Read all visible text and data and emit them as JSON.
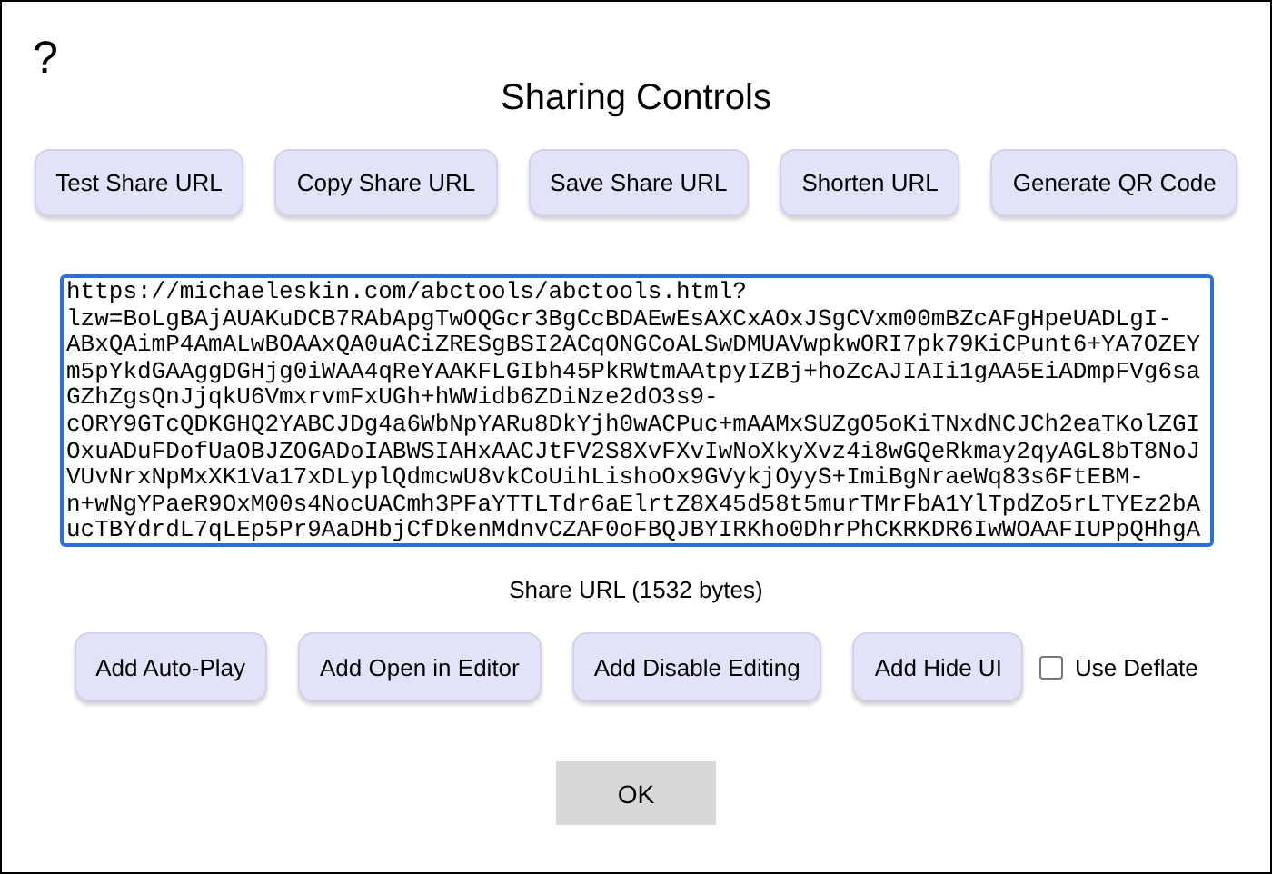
{
  "help_glyph": "?",
  "title": "Sharing Controls",
  "top_buttons": [
    "Test Share URL",
    "Copy Share URL",
    "Save Share URL",
    "Shorten URL",
    "Generate QR Code"
  ],
  "share_url_lines": [
    "https://michaeleskin.com/abctools/abctools.html?",
    "lzw=BoLgBAjAUAKuDCB7RAbApgTwOQGcr3BgCcBDAEwEsAXCxAOxJSgCVxm00mBZcAFgHpeUADLgI-",
    "ABxQAimP4AmALwBOAAxQA0uACiZRESgBSI2ACqONGCoALSwDMUAVwpkwORI7pk79KiCPunt6+YA7OZEY",
    "m5pYkdGAAggDGHjg0iWAA4qReYAAKFLGIbh45PkRWtmAAtpyIZBj+hoZcAJIAIi1gAA5EiADmpFVg6sa",
    "GZhZgsQnJjqkU6VmxrvmFxUGh+hWWidb6ZDiNze2dO3s9-",
    "cORY9GTcQDKGHQ2YABCJDg4a6WbNpYARu8DkYjh0wACPuc+mAAMxSUZgO5oKiTNxdNCJCh2eaTKolZGI",
    "OxuADuFDofUaOBJZOGADoIABWSIAHxAACJtFV2S8XvFXvIwNoXkyXvz4i8wGQeRkmay2qyAGL8bT8NoJ",
    "VUvNrxNpMxXK1Va17xDLyplQdmcwU8vkCoUihLishoOx9GVykjOyyS+ImiBgNraeWq83s6FtEBM-",
    "n+wNgYPaeR9OxM00s4NocUACmh3PFaYTTLTdr6aElrtZ8X45d58t5murTMrFbA1YlTpdZo5rLTYEz2bA",
    "ucTBYdrdL7qLEp5Pr9AaDHbjCfDkenMdnvCZAF0oFBQJBYIRKho0DhrPhCKRKDR6IwWOAAFIUPpQHhgA"
  ],
  "share_url_caption": "Share URL (1532 bytes)",
  "bottom_buttons": [
    "Add Auto-Play",
    "Add Open in Editor",
    "Add Disable Editing",
    "Add Hide UI"
  ],
  "deflate": {
    "label": "Use Deflate",
    "checked": false
  },
  "ok_button": "OK"
}
